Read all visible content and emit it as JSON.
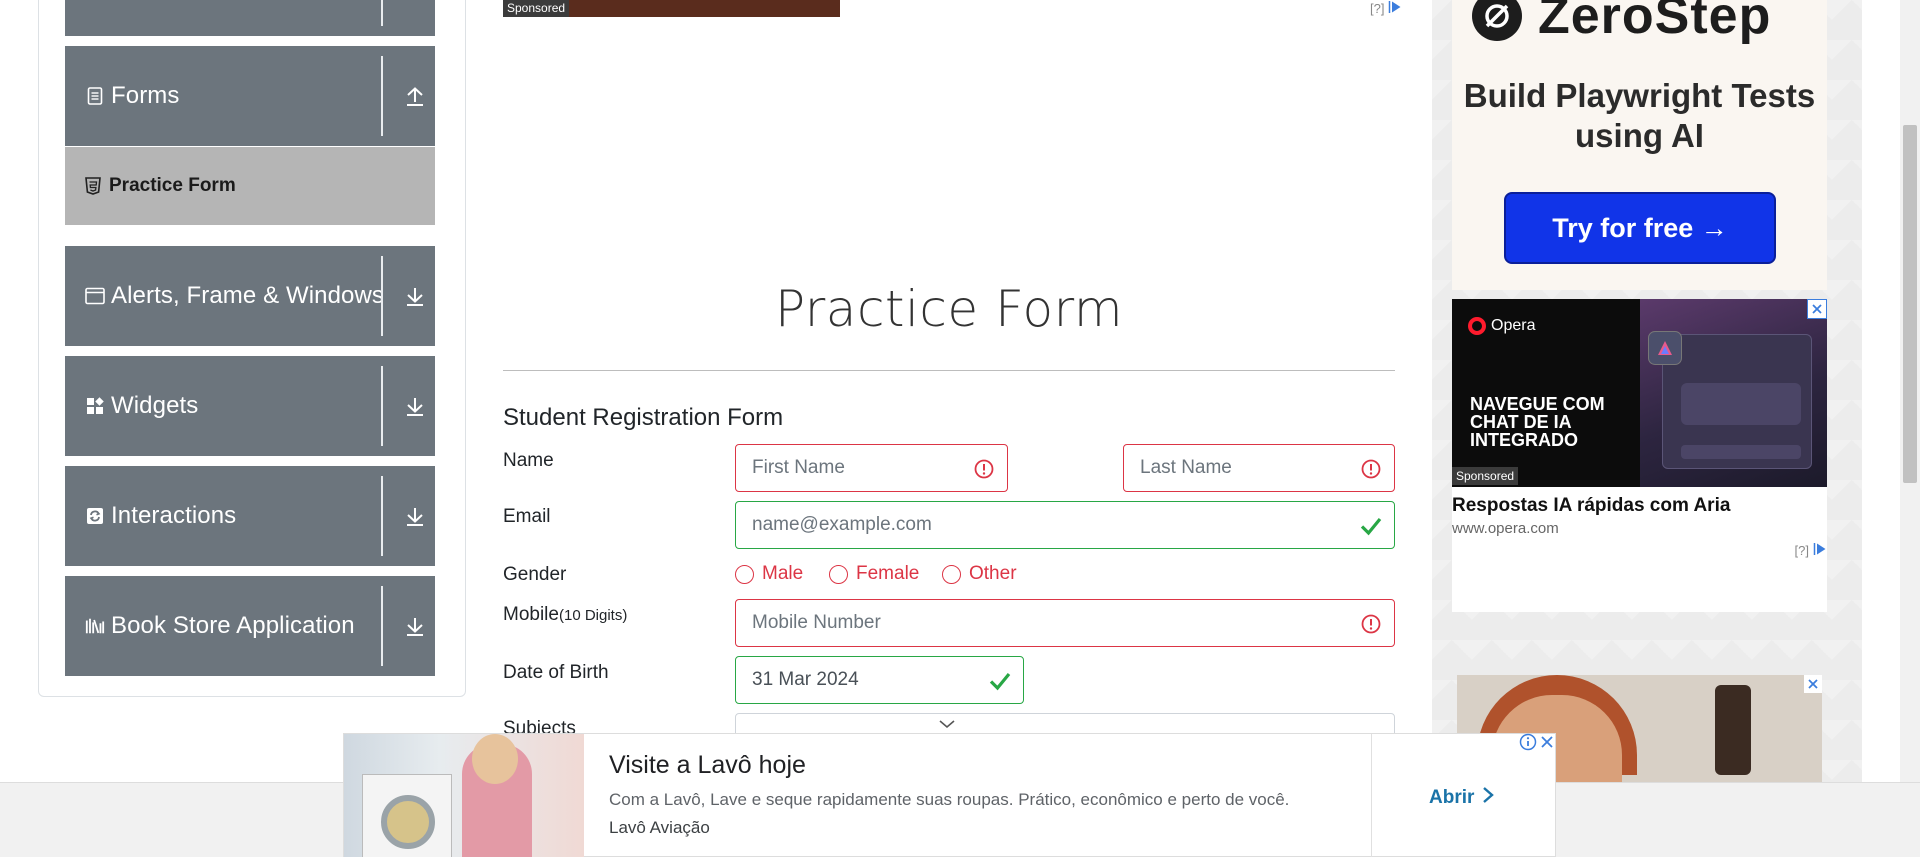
{
  "sidebar": {
    "groups": [
      {
        "label": "Forms",
        "icon": "document-icon",
        "state": "expanded"
      },
      {
        "label": "Alerts, Frame & Windows",
        "icon": "window-icon",
        "state": "collapsed"
      },
      {
        "label": "Widgets",
        "icon": "widgets-icon",
        "state": "collapsed"
      },
      {
        "label": "Interactions",
        "icon": "interactions-icon",
        "state": "collapsed"
      },
      {
        "label": "Book Store Application",
        "icon": "bookshelf-icon",
        "state": "collapsed"
      }
    ],
    "active_item": {
      "label": "Practice Form",
      "icon": "html5-icon"
    }
  },
  "top_ad": {
    "sponsored": "Sponsored",
    "help": "[?]"
  },
  "page_title": "Practice Form",
  "form": {
    "title": "Student Registration Form",
    "name_label": "Name",
    "first_name_placeholder": "First Name",
    "last_name_placeholder": "Last Name",
    "email_label": "Email",
    "email_placeholder": "name@example.com",
    "gender_label": "Gender",
    "gender_options": [
      "Male",
      "Female",
      "Other"
    ],
    "mobile_label": "Mobile",
    "mobile_hint": "(10 Digits)",
    "mobile_placeholder": "Mobile Number",
    "dob_label": "Date of Birth",
    "dob_value": "31 Mar 2024",
    "subjects_label": "Subjects"
  },
  "ads": {
    "zerostep": {
      "brand": "ZeroStep",
      "headline": "Build Playwright Tests using AI",
      "cta": "Try for free →"
    },
    "opera": {
      "brand": "Opera",
      "tagline": "NAVEGUE COM CHAT DE IA INTEGRADO",
      "sponsored": "Sponsored",
      "headline": "Respostas IA rápidas com Aria",
      "url": "www.opera.com",
      "help": "[?]"
    },
    "bottom": {
      "title": "Visite a Lavô hoje",
      "description": "Com a Lavô, Lave e seque rapidamente suas roupas. Prático, econômico e perto de você.",
      "source": "Lavô Aviação",
      "cta": "Abrir"
    }
  },
  "colors": {
    "sidebar_bg": "#6c757d",
    "active_item_bg": "#b5b5b5",
    "invalid": "#dc3545",
    "valid": "#28a745",
    "cta_blue": "#1134e8",
    "link_blue": "#1a73a8"
  }
}
